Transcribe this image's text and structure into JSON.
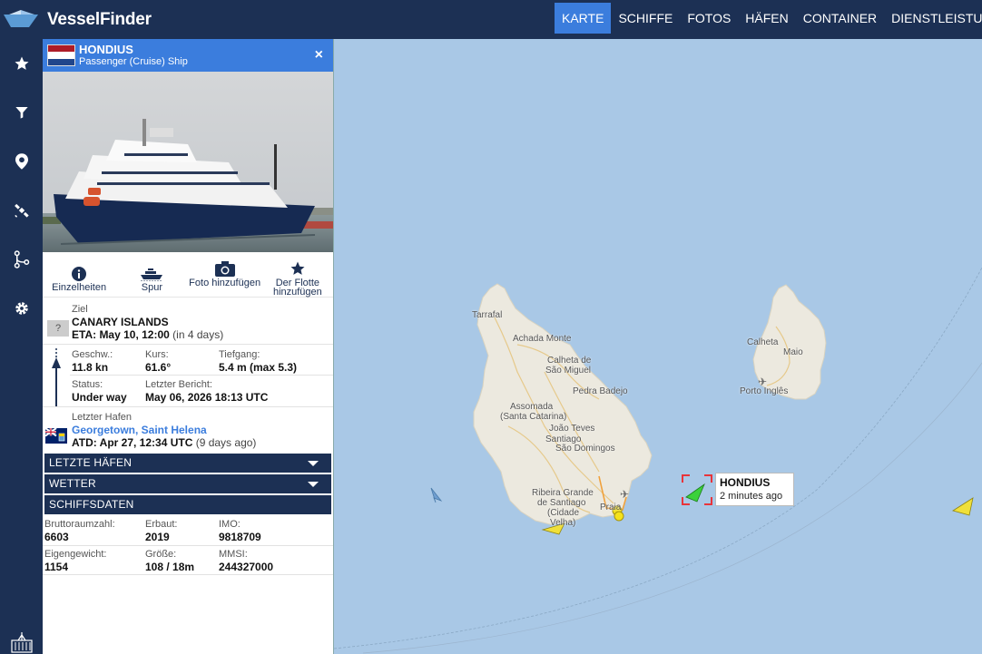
{
  "brand": {
    "name_part1": "Vessel",
    "name_part2": "Finder"
  },
  "nav": [
    {
      "label": "KARTE",
      "active": true
    },
    {
      "label": "SCHIFFE"
    },
    {
      "label": "FOTOS"
    },
    {
      "label": "HÄFEN"
    },
    {
      "label": "CONTAINER"
    },
    {
      "label": "DIENSTLEISTUN"
    }
  ],
  "sidebar": [
    "star-icon",
    "filter-icon",
    "map-pin-icon",
    "satellite-icon",
    "route-icon",
    "gear-icon",
    "container-icon"
  ],
  "vessel": {
    "name": "HONDIUS",
    "type": "Passenger (Cruise) Ship",
    "flag": {
      "colors": [
        "#ae1c28",
        "#ffffff",
        "#21468b"
      ]
    },
    "close": "×"
  },
  "actions": [
    {
      "icon": "info-icon",
      "label": "Einzelheiten"
    },
    {
      "icon": "ship-track-icon",
      "label": "Spur"
    },
    {
      "icon": "camera-icon",
      "label": "Foto hinzufügen"
    },
    {
      "icon": "star-icon",
      "label": "Der Flotte hinzufügen"
    }
  ],
  "destination": {
    "label": "Ziel",
    "unknown_flag": "?",
    "value": "CANARY ISLANDS",
    "eta": "ETA: May 10, 12:00",
    "eta_rel": "(in 4 days)"
  },
  "motion": {
    "speed_label": "Geschw.:",
    "speed": "11.8 kn",
    "course_label": "Kurs:",
    "course": "61.6°",
    "draught_label": "Tiefgang:",
    "draught": "5.4 m (max 5.3)",
    "status_label": "Status:",
    "status": "Under way",
    "report_label": "Letzter Bericht:",
    "report": "May 06, 2026 18:13 UTC"
  },
  "last_port": {
    "label": "Letzter Hafen",
    "port": "Georgetown, Saint Helena",
    "atd": "ATD: Apr 27, 12:34 UTC",
    "atd_rel": "(9 days ago)"
  },
  "sections": [
    "LETZTE HÄFEN",
    "WETTER",
    "SCHIFFSDATEN"
  ],
  "ship_data": {
    "gt_label": "Bruttoraumzahl:",
    "gt": "6603",
    "built_label": "Erbaut:",
    "built": "2019",
    "imo_label": "IMO:",
    "imo": "9818709",
    "dwt_label": "Eigengewicht:",
    "dwt": "1154",
    "size_label": "Größe:",
    "size": "108 / 18m",
    "mmsi_label": "MMSI:",
    "mmsi": "244327000"
  },
  "map": {
    "places": [
      "Tarrafal",
      "Achada Monte",
      "Calheta de",
      "São Miguel",
      "Pedra Badejo",
      "Assomada",
      "(Santa Catarina)",
      "João Teves",
      "Santiago",
      "São Domingos",
      "Ribeira Grande",
      "de Santiago",
      "(Cidade",
      "Velha)",
      "Praia",
      "Calheta",
      "Maio",
      "Porto Inglês"
    ],
    "vessel_label": {
      "name": "HONDIUS",
      "time": "2 minutes ago"
    }
  }
}
